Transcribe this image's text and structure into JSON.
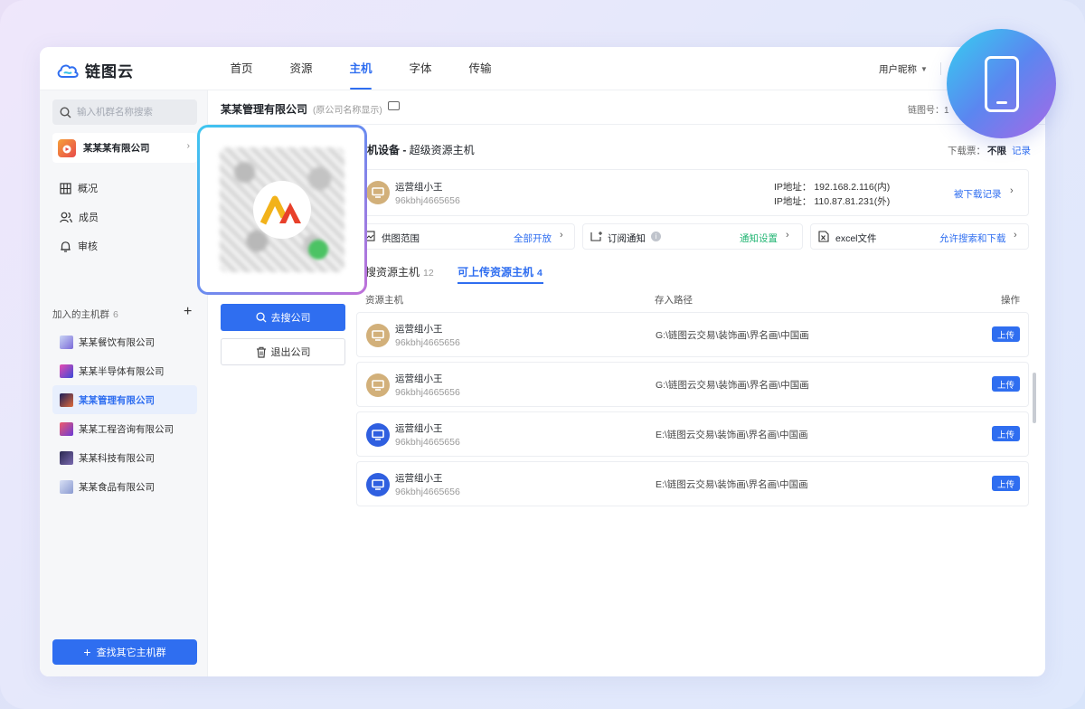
{
  "app": {
    "name": "链图云"
  },
  "nav": {
    "items": [
      "首页",
      "资源",
      "主机",
      "字体",
      "传输"
    ],
    "active": "主机"
  },
  "user": {
    "nickname": "用户昵称"
  },
  "sidebar": {
    "search_placeholder": "输入机群名称搜索",
    "company": "某某某有限公司",
    "menu": [
      {
        "label": "概况",
        "icon": "grid-icon"
      },
      {
        "label": "成员",
        "icon": "members-icon"
      },
      {
        "label": "审核",
        "icon": "bell-icon"
      }
    ],
    "group_title": "加入的主机群",
    "group_count": "6",
    "groups": [
      {
        "label": "某某餐饮有限公司",
        "color": "#9aa7e8"
      },
      {
        "label": "某某半导体有限公司",
        "color": "#8a4fd0"
      },
      {
        "label": "某某管理有限公司",
        "color": "#3a3f8f",
        "active": true
      },
      {
        "label": "某某工程咨询有限公司",
        "color": "#e85a8a"
      },
      {
        "label": "某某科技有限公司",
        "color": "#3c3a6a"
      },
      {
        "label": "某某食品有限公司",
        "color": "#a8b8e0"
      }
    ],
    "find_button": "查找其它主机群"
  },
  "header": {
    "title": "某某管理有限公司",
    "subtitle": "(原公司名称显示)",
    "chain_label": "链图号：1"
  },
  "company_panel": {
    "search_button": "去搜公司",
    "exit_button": "退出公司"
  },
  "section": {
    "title": "机设备 - ",
    "subtitle": "超级资源主机",
    "quota_label": "下载票：",
    "quota_value": "不限",
    "record_link": "记录"
  },
  "device": {
    "name": "运营组小王",
    "id": "96kbhj4665656",
    "ip_inner": "IP地址：  192.168.2.116(内)",
    "ip_outer": "IP地址：  110.87.81.231(外)",
    "download_records": "被下载记录"
  },
  "options": [
    {
      "label": "供图范围",
      "value": "全部开放",
      "value_color": "#2f6ef0",
      "icon": "image-icon"
    },
    {
      "label": "订阅通知",
      "value": "通知设置",
      "value_color": "#22b573",
      "icon": "subscribe-icon"
    },
    {
      "label": "excel文件",
      "value": "允许搜索和下载",
      "value_color": "#2f6ef0",
      "icon": "excel-icon"
    }
  ],
  "tabs": [
    {
      "label": "搜资源主机",
      "count": "12",
      "active": false
    },
    {
      "label": "可上传资源主机",
      "count": "4",
      "active": true
    }
  ],
  "table": {
    "headers": {
      "host": "资源主机",
      "path": "存入路径",
      "action": "操作"
    },
    "rows": [
      {
        "name": "运营组小王",
        "id": "96kbhj4665656",
        "path": "G:\\链图云交易\\装饰画\\界名画\\中国画",
        "avatar": "tan",
        "action": "上传"
      },
      {
        "name": "运营组小王",
        "id": "96kbhj4665656",
        "path": "G:\\链图云交易\\装饰画\\界名画\\中国画",
        "avatar": "tan",
        "action": "上传"
      },
      {
        "name": "运营组小王",
        "id": "96kbhj4665656",
        "path": "E:\\链图云交易\\装饰画\\界名画\\中国画",
        "avatar": "blue",
        "action": "上传"
      },
      {
        "name": "运营组小王",
        "id": "96kbhj4665656",
        "path": "E:\\链图云交易\\装饰画\\界名画\\中国画",
        "avatar": "blue",
        "action": "上传"
      }
    ]
  }
}
